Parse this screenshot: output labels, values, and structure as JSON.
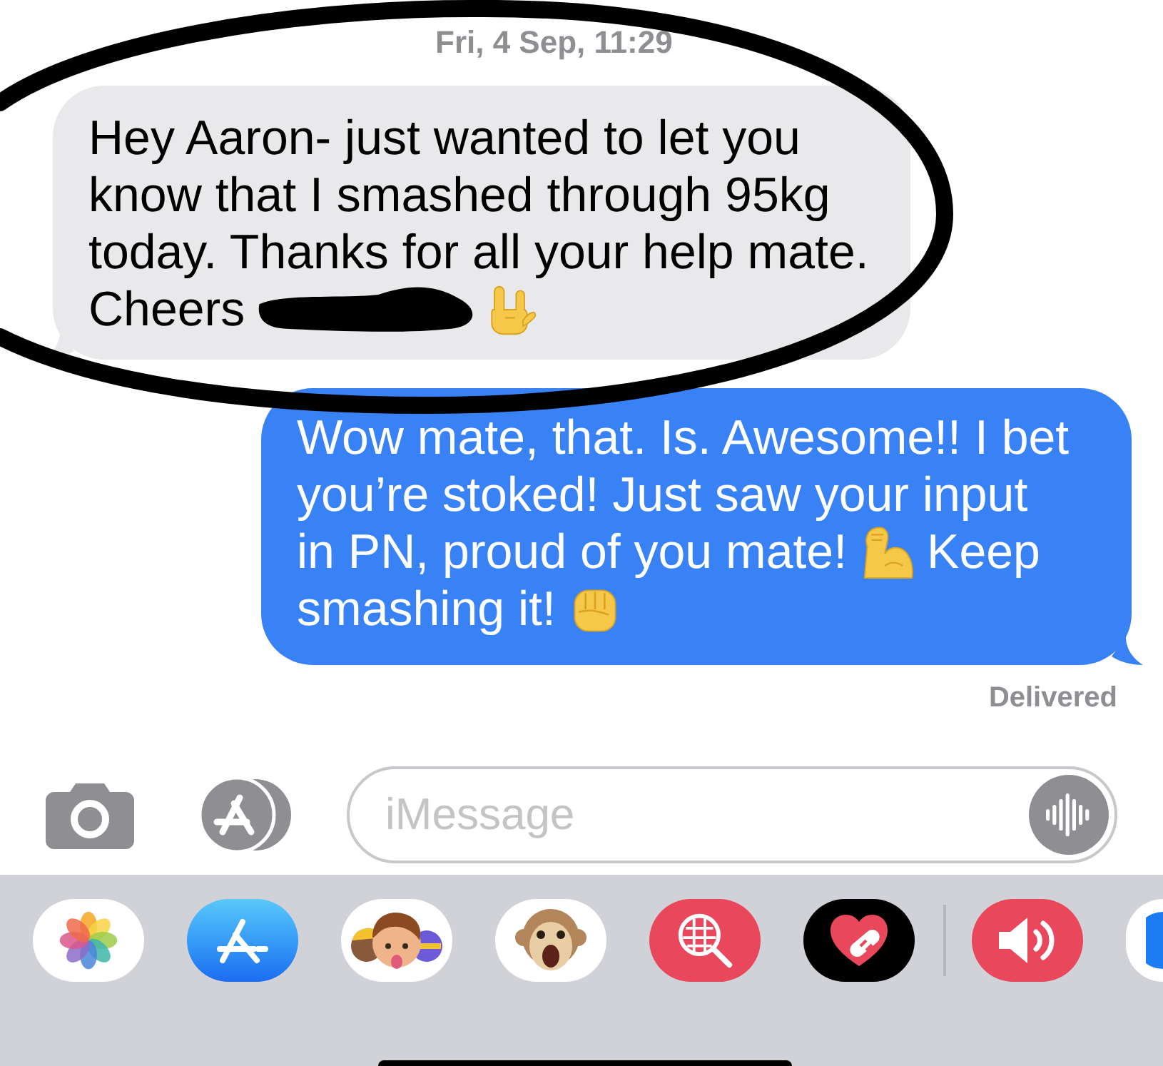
{
  "timestamp": "Fri, 4 Sep, 11:29",
  "messages": [
    {
      "kind": "received",
      "lines": [
        {
          "parts": [
            {
              "kind": "text",
              "text": "Hey Aaron- just wanted to let you know that I smashed through 95kg today. Thanks for all your help mate."
            }
          ]
        },
        {
          "parts": [
            {
              "kind": "text",
              "text": "Cheers"
            },
            {
              "kind": "redaction"
            },
            {
              "kind": "horns"
            }
          ]
        }
      ]
    },
    {
      "kind": "sent",
      "lines": [
        {
          "parts": [
            {
              "kind": "text",
              "text": "Wow mate, that. Is. Awesome!! I bet you’re stoked! Just saw your input"
            }
          ]
        },
        {
          "parts": [
            {
              "kind": "text",
              "text": "in PN, proud of you mate!"
            },
            {
              "kind": "biceps"
            },
            {
              "kind": "text",
              "text": "Keep"
            }
          ]
        },
        {
          "parts": [
            {
              "kind": "text",
              "text": "smashing it!"
            },
            {
              "kind": "fist"
            }
          ]
        }
      ]
    }
  ],
  "status": "Delivered",
  "composer": {
    "placeholder": "iMessage"
  }
}
